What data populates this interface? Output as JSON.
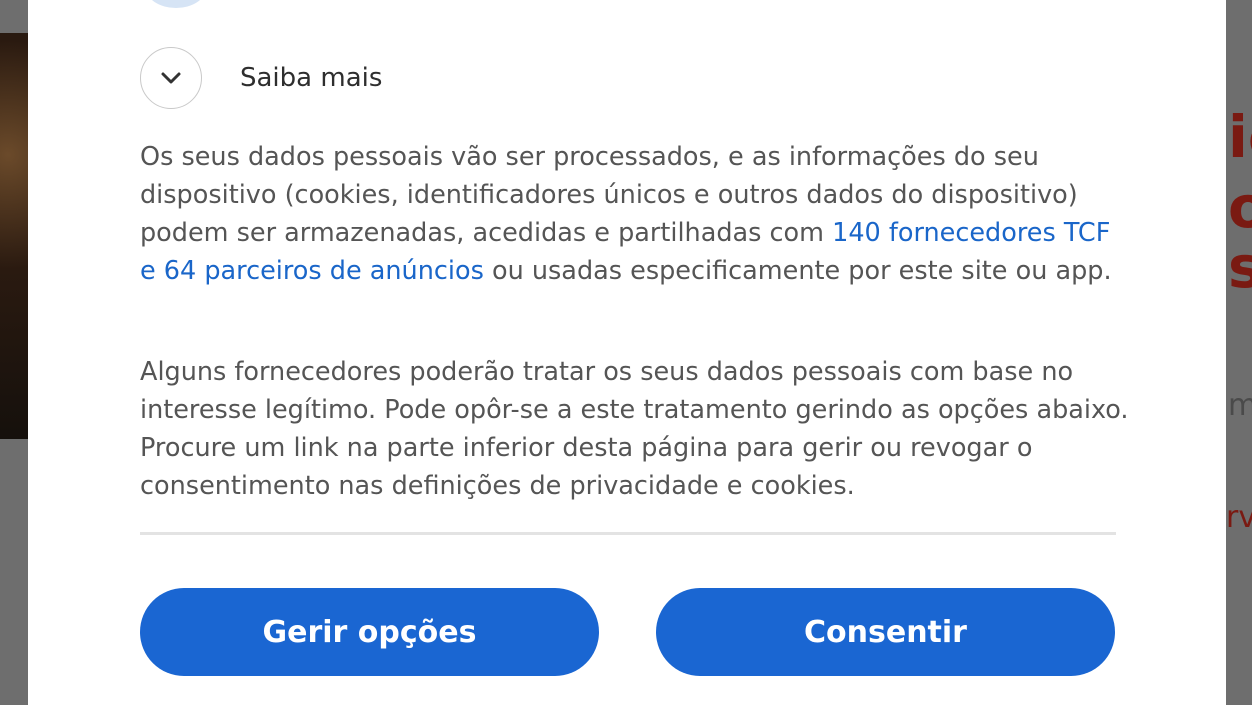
{
  "background": {
    "right_title_fragments": [
      "ic",
      "os",
      "s"
    ],
    "right_text_fragments": [
      "m",
      "rv"
    ]
  },
  "learn_more": {
    "label": "Saiba mais",
    "icon": "chevron-down-icon"
  },
  "paragraph1": {
    "before_link": "Os seus dados pessoais vão ser processados, e as informações do seu dispositivo (cookies, identificadores únicos e outros dados do dispositivo) podem ser armazenadas, acedidas e partilhadas com ",
    "link": "140 fornecedores TCF e 64 parceiros de anúncios",
    "after_link": " ou usadas especificamente por este site ou app."
  },
  "paragraph2": {
    "text": "Alguns fornecedores poderão tratar os seus dados pessoais com base no interesse legítimo. Pode opôr-se a este tratamento gerindo as opções abaixo. Procure um link na parte inferior desta página para gerir ou revogar o consentimento nas definições de privacidade e cookies."
  },
  "buttons": {
    "manage_label": "Gerir opções",
    "consent_label": "Consentir"
  },
  "colors": {
    "accent": "#1a66d2",
    "link": "#1a66c9",
    "text": "#555555",
    "background_headline": "#7a1a12"
  }
}
